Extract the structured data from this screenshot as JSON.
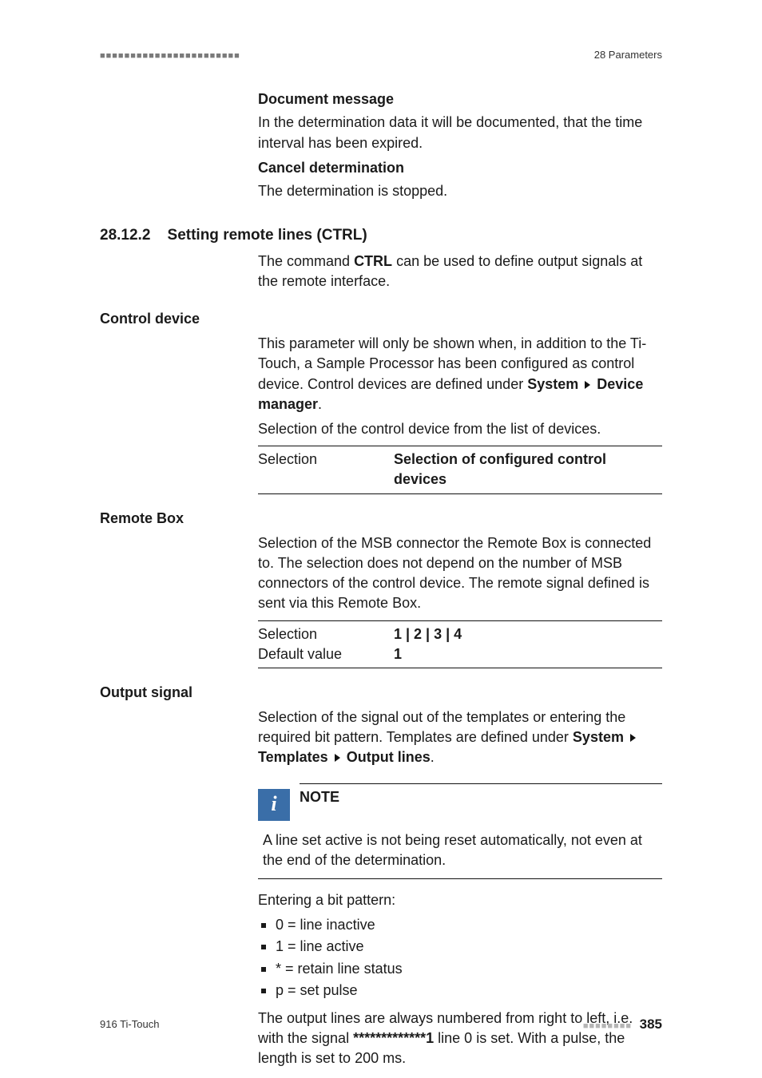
{
  "header": {
    "chapter": "28 Parameters"
  },
  "footer": {
    "product": "916 Ti-Touch",
    "page_number": "385"
  },
  "intro": {
    "doc_msg_h": "Document message",
    "doc_msg_p": "In the determination data it will be documented, that the time interval has been expired.",
    "cancel_h": "Cancel determination",
    "cancel_p": "The determination is stopped."
  },
  "section": {
    "num": "28.12.2",
    "title": "Setting remote lines (CTRL)",
    "intro_pre": "The command ",
    "intro_cmd": "CTRL",
    "intro_post": " can be used to define output signals at the remote interface."
  },
  "control_device": {
    "label": "Control device",
    "p1_pre": "This parameter will only be shown when, in addition to the Ti-Touch, a Sample Processor has been configured as control device. Control devices are defined under ",
    "path1": "System",
    "path2": "Device manager",
    "p1_post": ".",
    "p2": "Selection of the control device from the list of devices.",
    "sel_label": "Selection",
    "sel_value": "Selection of configured control devices"
  },
  "remote_box": {
    "label": "Remote Box",
    "p1": "Selection of the MSB connector the Remote Box is connected to. The selection does not depend on the number of MSB connectors of the control device. The remote signal defined is sent via this Remote Box.",
    "sel_label": "Selection",
    "sel_value": "1 | 2 | 3 | 4",
    "def_label": "Default value",
    "def_value": "1"
  },
  "output_signal": {
    "label": "Output signal",
    "p1_pre": "Selection of the signal out of the templates or entering the required bit pattern. Templates are defined under ",
    "path1": "System",
    "path2": "Templates",
    "path3": "Output lines",
    "p1_post": ".",
    "note_title": "NOTE",
    "note_body": "A line set active is not being reset automatically, not even at the end of the determination.",
    "bits_intro": "Entering a bit pattern:",
    "bits": [
      "0 = line inactive",
      "1 = line active",
      "* = retain line status",
      "p = set pulse"
    ],
    "tail_pre": "The output lines are always numbered from right to left, i.e. with the signal ",
    "tail_sig": "*************1",
    "tail_post": " line 0 is set. With a pulse, the length is set to 200 ms."
  }
}
